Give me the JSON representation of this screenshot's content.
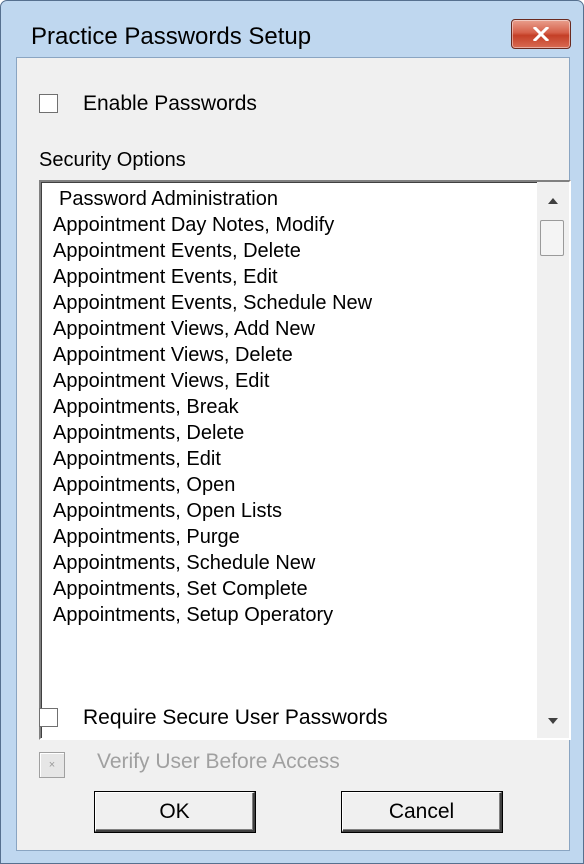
{
  "window": {
    "title": "Practice Passwords Setup"
  },
  "options": {
    "enable_passwords_label": "Enable Passwords",
    "enable_passwords_checked": false,
    "security_options_label": "Security Options",
    "require_secure_label": "Require Secure User Passwords",
    "require_secure_checked": false,
    "verify_user_label": "Verify User Before Access",
    "verify_user_mark": "×",
    "verify_user_enabled": false
  },
  "security_list": {
    "items": [
      "Password Administration",
      "Appointment Day Notes, Modify",
      "Appointment Events, Delete",
      "Appointment Events, Edit",
      "Appointment Events, Schedule New",
      "Appointment Views, Add New",
      "Appointment Views, Delete",
      "Appointment Views, Edit",
      "Appointments, Break",
      "Appointments, Delete",
      "Appointments, Edit",
      "Appointments, Open",
      "Appointments, Open Lists",
      "Appointments, Purge",
      "Appointments, Schedule New",
      "Appointments, Set Complete",
      "Appointments, Setup Operatory"
    ]
  },
  "buttons": {
    "ok": "OK",
    "cancel": "Cancel"
  },
  "icons": {
    "close": "close-icon",
    "scroll_up": "scroll-up-arrow-icon",
    "scroll_down": "scroll-down-arrow-icon"
  },
  "colors": {
    "frame": "#bfd7ef",
    "client": "#f0f0f0",
    "close_button": "#c94a33"
  }
}
